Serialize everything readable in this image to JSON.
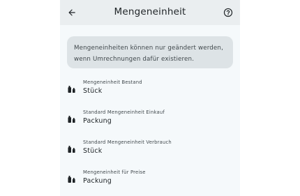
{
  "header": {
    "title": "Mengeneinheit",
    "back_icon": "arrow-left-icon",
    "help_icon": "help-circle-icon"
  },
  "info": {
    "text_line1": "Mengeneinheiten können nur geändert werden,",
    "text_line2": "wenn Umrechnungen dafür existieren."
  },
  "items": [
    {
      "label": "Mengeneinheit Bestand",
      "value": "Stück",
      "icon": "bottles-icon"
    },
    {
      "label": "Standard Mengeneinheit Einkauf",
      "value": "Packung",
      "icon": "bottles-icon"
    },
    {
      "label": "Standard Mengeneinheit Verbrauch",
      "value": "Stück",
      "icon": "bottles-icon"
    },
    {
      "label": "Mengeneinheit für Preise",
      "value": "Packung",
      "icon": "bottles-icon"
    }
  ],
  "colors": {
    "screen_background": "#f5f9fb",
    "topbar_background": "#eaeef0",
    "info_background": "#dde3e6",
    "text_primary": "#1e2326",
    "text_secondary": "#40484c"
  }
}
